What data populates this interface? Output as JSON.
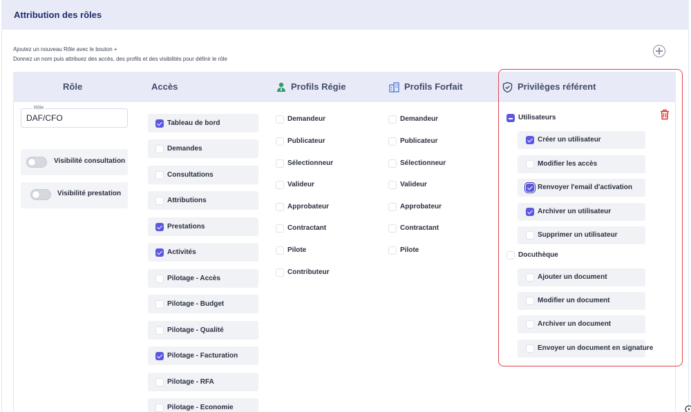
{
  "page": {
    "title": "Attribution des rôles"
  },
  "helper": {
    "line1": "Ajoutez un nouveau Rôle avec le bouton +",
    "line2": "Donnez un nom puis attribuez des accès, des profils et des visibilités pour définir le rôle"
  },
  "table": {
    "headers": {
      "role": "Rôle",
      "acces": "Accès",
      "profils_regie": "Profils Régie",
      "profils_forfait": "Profils Forfait",
      "privileges": "Privilèges référent"
    }
  },
  "role": {
    "field_label": "Rôle",
    "value": "DAF/CFO",
    "toggles": [
      {
        "label": "Visibilité consultation",
        "on": false
      },
      {
        "label": "Visibilité prestation",
        "on": false
      }
    ]
  },
  "acces": [
    {
      "label": "Tableau de bord",
      "checked": true
    },
    {
      "label": "Demandes",
      "checked": false
    },
    {
      "label": "Consultations",
      "checked": false
    },
    {
      "label": "Attributions",
      "checked": false
    },
    {
      "label": "Prestations",
      "checked": true
    },
    {
      "label": "Activités",
      "checked": true
    },
    {
      "label": "Pilotage - Accès",
      "checked": false
    },
    {
      "label": "Pilotage - Budget",
      "checked": false
    },
    {
      "label": "Pilotage - Qualité",
      "checked": false
    },
    {
      "label": "Pilotage - Facturation",
      "checked": true
    },
    {
      "label": "Pilotage - RFA",
      "checked": false
    },
    {
      "label": "Pilotage - Economie",
      "checked": false
    }
  ],
  "profils_regie": [
    {
      "label": "Demandeur",
      "checked": false
    },
    {
      "label": "Publicateur",
      "checked": false
    },
    {
      "label": "Sélectionneur",
      "checked": false
    },
    {
      "label": "Valideur",
      "checked": false
    },
    {
      "label": "Approbateur",
      "checked": false
    },
    {
      "label": "Contractant",
      "checked": false
    },
    {
      "label": "Pilote",
      "checked": false
    },
    {
      "label": "Contributeur",
      "checked": false
    }
  ],
  "profils_forfait": [
    {
      "label": "Demandeur",
      "checked": false
    },
    {
      "label": "Publicateur",
      "checked": false
    },
    {
      "label": "Sélectionneur",
      "checked": false
    },
    {
      "label": "Valideur",
      "checked": false
    },
    {
      "label": "Approbateur",
      "checked": false
    },
    {
      "label": "Contractant",
      "checked": false
    },
    {
      "label": "Pilote",
      "checked": false
    }
  ],
  "privileges": {
    "utilisateurs": {
      "label": "Utilisateurs",
      "state": "indeterminate",
      "items": [
        {
          "label": "Créer un utilisateur",
          "checked": true
        },
        {
          "label": "Modifier les accès",
          "checked": false
        },
        {
          "label": "Renvoyer l'email d'activation",
          "checked": true,
          "focused": true
        },
        {
          "label": "Archiver un utilisateur",
          "checked": true
        },
        {
          "label": "Supprimer un utilisateur",
          "checked": false
        }
      ]
    },
    "docutheque": {
      "label": "Docuthèque",
      "state": "unchecked",
      "items": [
        {
          "label": "Ajouter un document",
          "checked": false
        },
        {
          "label": "Modifier un document",
          "checked": false
        },
        {
          "label": "Archiver un document",
          "checked": false
        },
        {
          "label": "Envoyer un document en signature",
          "checked": false
        }
      ]
    }
  },
  "icons": {
    "add": "plus-circle-icon",
    "regie": "person-icon",
    "forfait": "building-icon",
    "privileges": "shield-check-icon",
    "delete": "trash-icon"
  },
  "colors": {
    "accent": "#5b57e0",
    "header_bg": "#e8ebf7",
    "title": "#1f2a6b",
    "highlight_border": "#e0424b",
    "trash": "#d9302c",
    "profile_icon": "#2e9b6a"
  }
}
